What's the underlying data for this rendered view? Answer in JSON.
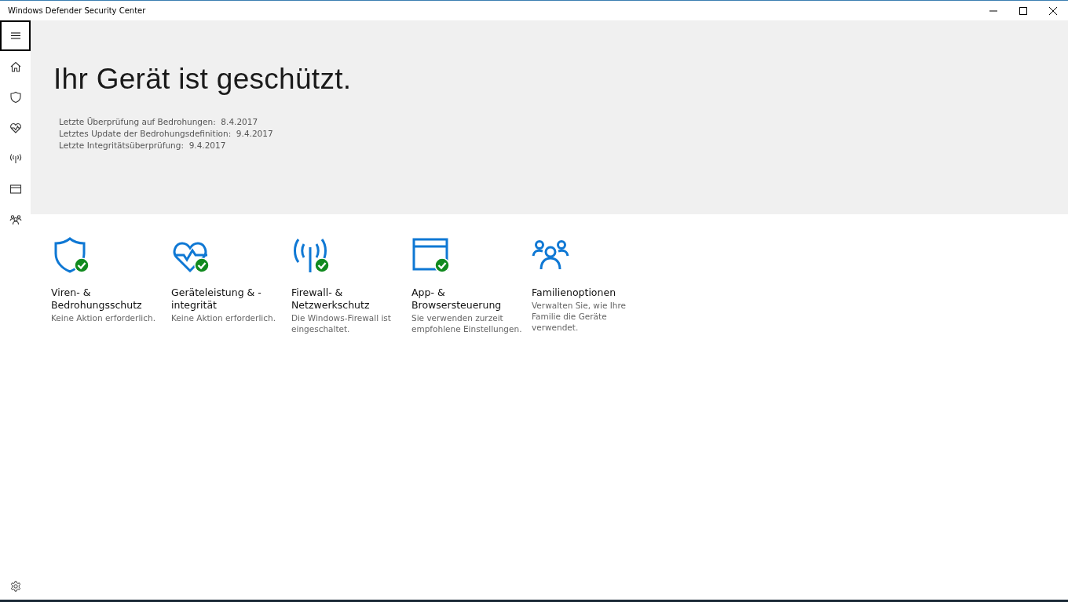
{
  "window": {
    "title": "Windows Defender Security Center"
  },
  "sidebar": {
    "items": [
      {
        "kind": "home"
      },
      {
        "kind": "shield"
      },
      {
        "kind": "heart"
      },
      {
        "kind": "antenna"
      },
      {
        "kind": "browser"
      },
      {
        "kind": "family"
      }
    ]
  },
  "hero": {
    "title": "Ihr Gerät ist geschützt.",
    "lines": [
      "Letzte Überprüfung auf Bedrohungen:  8.4.2017",
      "Letztes Update der Bedrohungsdefinition:  9.4.2017",
      "Letzte Integritätsüberprüfung:  9.4.2017"
    ]
  },
  "tiles": [
    {
      "kind": "shield",
      "ok": true,
      "title": "Viren- & Bedrohungsschutz",
      "description": "Keine Aktion erforderlich."
    },
    {
      "kind": "heart",
      "ok": true,
      "title": "Geräteleistung & -integrität",
      "description": "Keine Aktion erforderlich."
    },
    {
      "kind": "antenna",
      "ok": true,
      "title": "Firewall- & Netzwerkschutz",
      "description": "Die Windows-Firewall ist eingeschaltet."
    },
    {
      "kind": "browser",
      "ok": true,
      "title": "App- & Browsersteuerung",
      "description": "Sie verwenden zurzeit empfohlene Einstellungen."
    },
    {
      "kind": "family",
      "ok": false,
      "title": "Familienoptionen",
      "description": "Verwalten Sie, wie Ihre Familie die Geräte verwendet."
    }
  ]
}
